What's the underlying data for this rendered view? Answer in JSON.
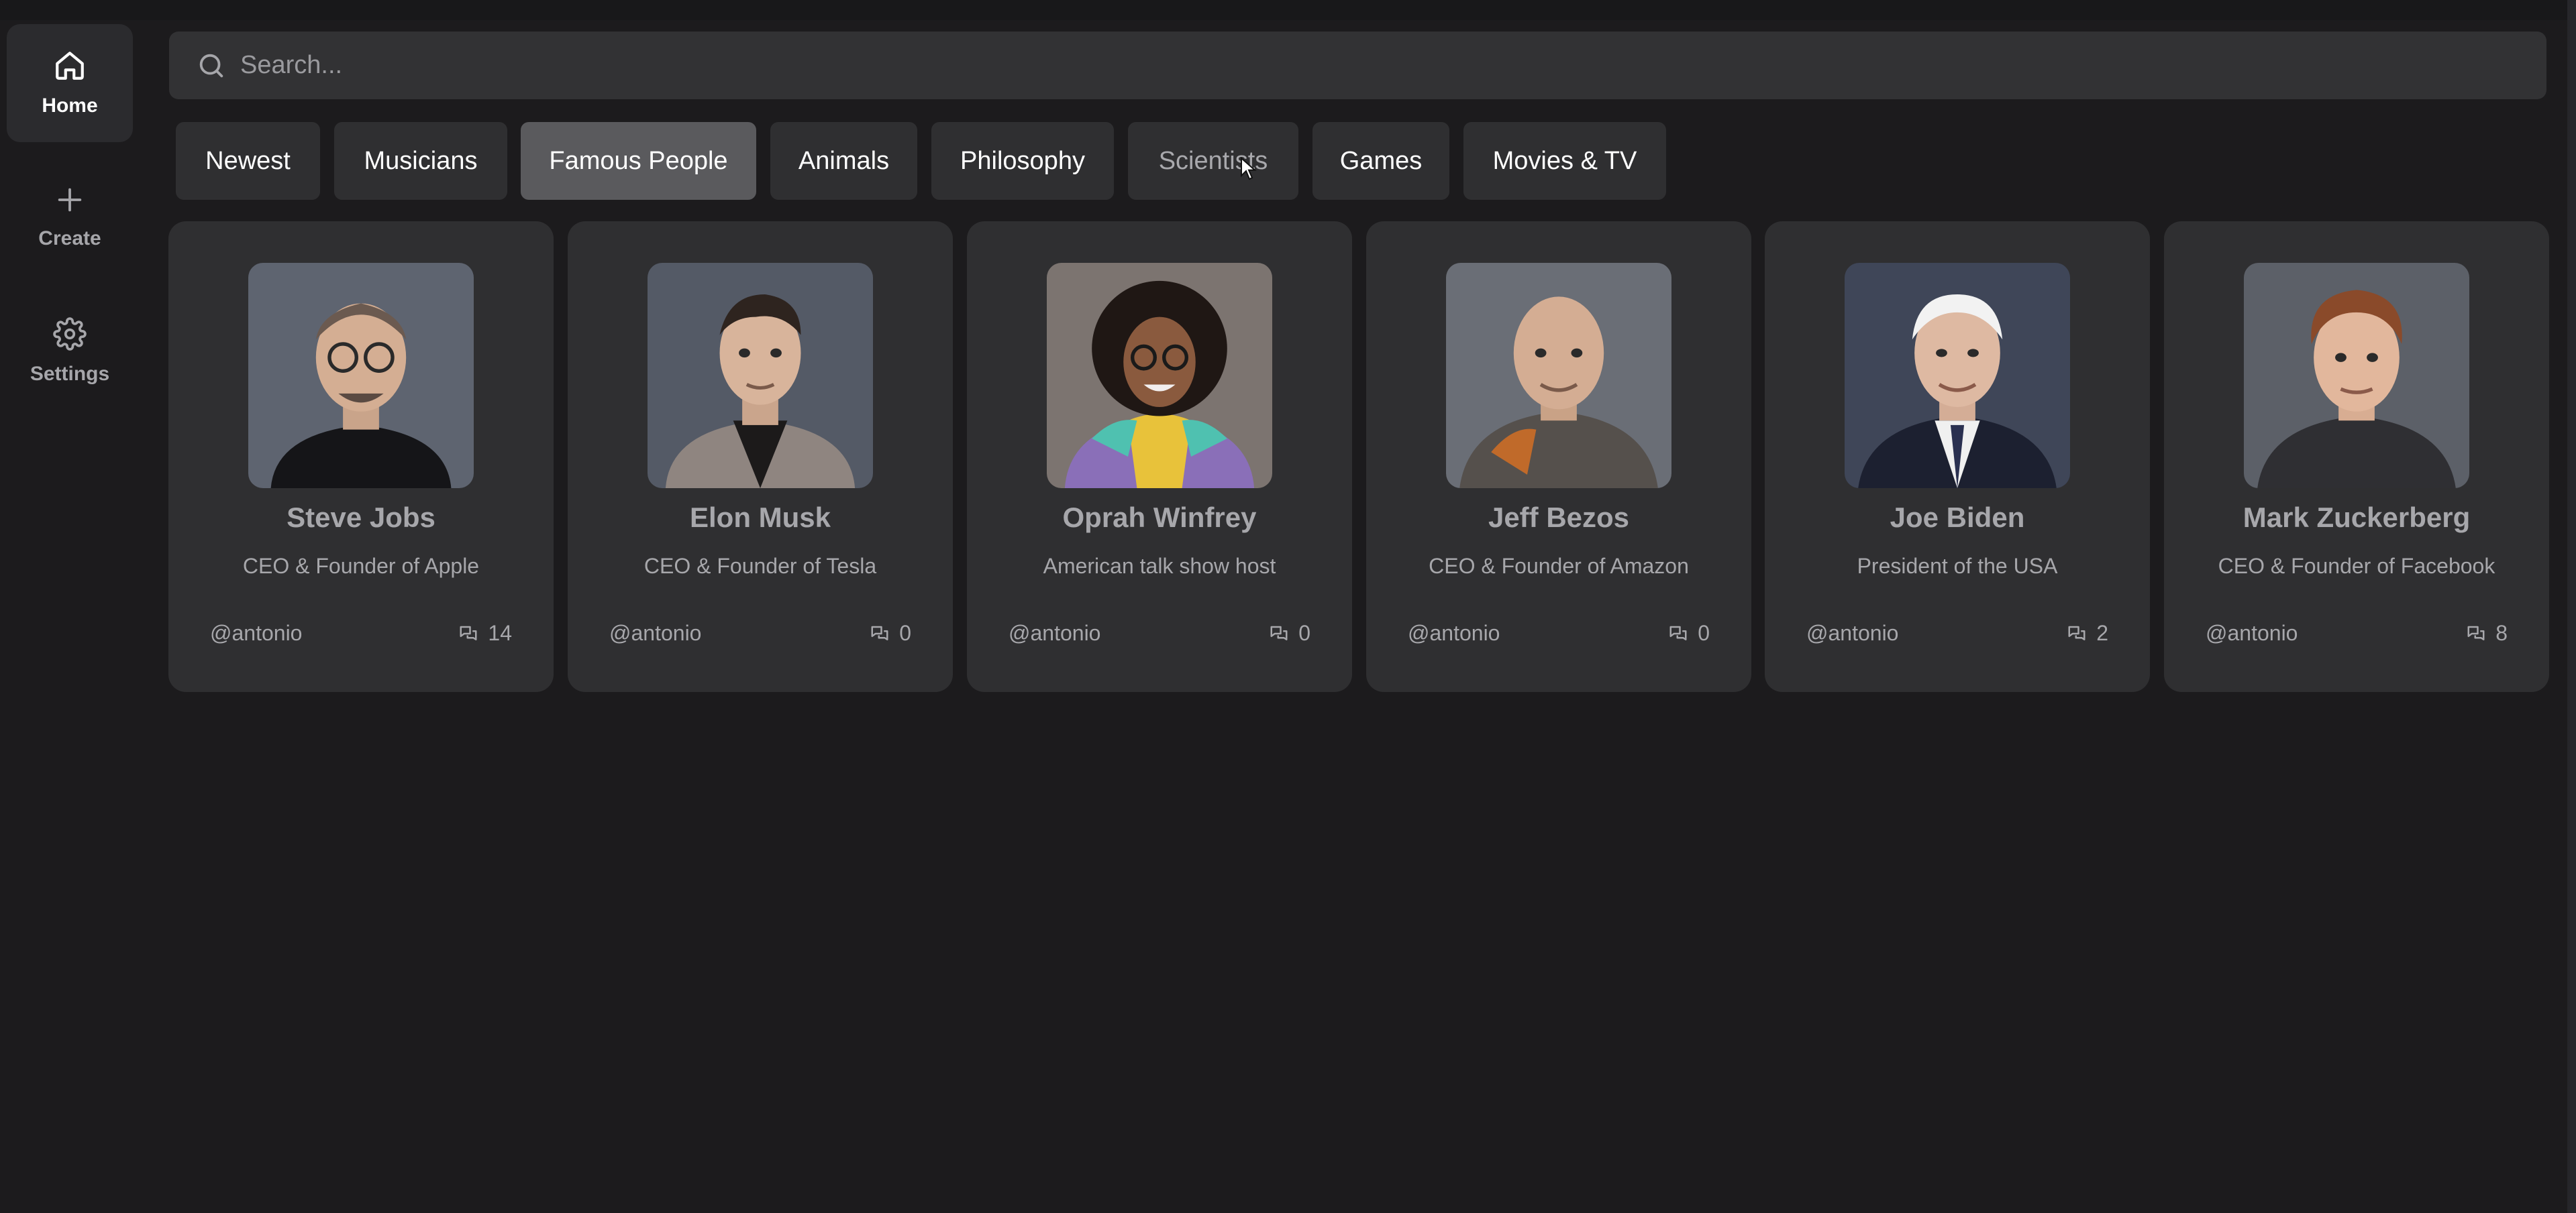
{
  "sidebar": {
    "items": [
      {
        "label": "Home",
        "icon": "home-icon",
        "active": true
      },
      {
        "label": "Create",
        "icon": "plus-icon",
        "active": false
      },
      {
        "label": "Settings",
        "icon": "gear-icon",
        "active": false
      }
    ]
  },
  "search": {
    "placeholder": "Search...",
    "value": ""
  },
  "categories": [
    {
      "label": "Newest"
    },
    {
      "label": "Musicians"
    },
    {
      "label": "Famous People",
      "active": true
    },
    {
      "label": "Animals"
    },
    {
      "label": "Philosophy"
    },
    {
      "label": "Scientists",
      "hovered": true
    },
    {
      "label": "Games"
    },
    {
      "label": "Movies & TV"
    }
  ],
  "companions": [
    {
      "name": "Steve Jobs",
      "description": "CEO & Founder of Apple",
      "handle": "@antonio",
      "messages": "14"
    },
    {
      "name": "Elon Musk",
      "description": "CEO & Founder of Tesla",
      "handle": "@antonio",
      "messages": "0"
    },
    {
      "name": "Oprah Winfrey",
      "description": "American talk show host",
      "handle": "@antonio",
      "messages": "0"
    },
    {
      "name": "Jeff Bezos",
      "description": "CEO & Founder of Amazon",
      "handle": "@antonio",
      "messages": "0"
    },
    {
      "name": "Joe Biden",
      "description": "President of the USA",
      "handle": "@antonio",
      "messages": "2"
    },
    {
      "name": "Mark Zuckerberg",
      "description": "CEO & Founder of Facebook",
      "handle": "@antonio",
      "messages": "8"
    }
  ],
  "colors": {
    "background": "#1c1b1d",
    "surface": "#2f2f31",
    "active_tab": "#5a5a5d",
    "muted_text": "#a7a7ab"
  }
}
